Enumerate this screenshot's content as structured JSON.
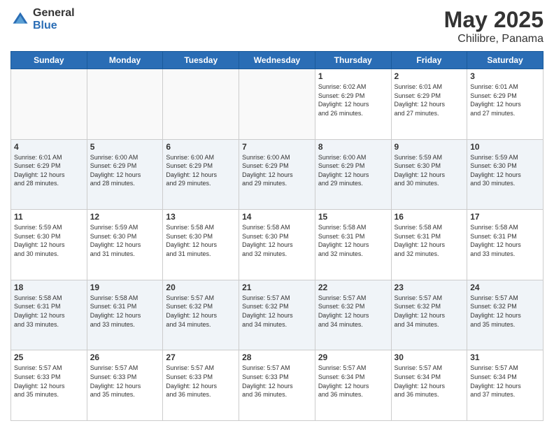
{
  "header": {
    "logo_general": "General",
    "logo_blue": "Blue",
    "title": "May 2025",
    "location": "Chilibre, Panama"
  },
  "weekdays": [
    "Sunday",
    "Monday",
    "Tuesday",
    "Wednesday",
    "Thursday",
    "Friday",
    "Saturday"
  ],
  "weeks": [
    [
      {
        "day": "",
        "empty": true
      },
      {
        "day": "",
        "empty": true
      },
      {
        "day": "",
        "empty": true
      },
      {
        "day": "",
        "empty": true
      },
      {
        "day": "1",
        "sunrise": "6:02 AM",
        "sunset": "6:29 PM",
        "daylight": "12 hours and 26 minutes."
      },
      {
        "day": "2",
        "sunrise": "6:01 AM",
        "sunset": "6:29 PM",
        "daylight": "12 hours and 27 minutes."
      },
      {
        "day": "3",
        "sunrise": "6:01 AM",
        "sunset": "6:29 PM",
        "daylight": "12 hours and 27 minutes."
      }
    ],
    [
      {
        "day": "4",
        "sunrise": "6:01 AM",
        "sunset": "6:29 PM",
        "daylight": "12 hours and 28 minutes."
      },
      {
        "day": "5",
        "sunrise": "6:00 AM",
        "sunset": "6:29 PM",
        "daylight": "12 hours and 28 minutes."
      },
      {
        "day": "6",
        "sunrise": "6:00 AM",
        "sunset": "6:29 PM",
        "daylight": "12 hours and 29 minutes."
      },
      {
        "day": "7",
        "sunrise": "6:00 AM",
        "sunset": "6:29 PM",
        "daylight": "12 hours and 29 minutes."
      },
      {
        "day": "8",
        "sunrise": "6:00 AM",
        "sunset": "6:29 PM",
        "daylight": "12 hours and 29 minutes."
      },
      {
        "day": "9",
        "sunrise": "5:59 AM",
        "sunset": "6:30 PM",
        "daylight": "12 hours and 30 minutes."
      },
      {
        "day": "10",
        "sunrise": "5:59 AM",
        "sunset": "6:30 PM",
        "daylight": "12 hours and 30 minutes."
      }
    ],
    [
      {
        "day": "11",
        "sunrise": "5:59 AM",
        "sunset": "6:30 PM",
        "daylight": "12 hours and 30 minutes."
      },
      {
        "day": "12",
        "sunrise": "5:59 AM",
        "sunset": "6:30 PM",
        "daylight": "12 hours and 31 minutes."
      },
      {
        "day": "13",
        "sunrise": "5:58 AM",
        "sunset": "6:30 PM",
        "daylight": "12 hours and 31 minutes."
      },
      {
        "day": "14",
        "sunrise": "5:58 AM",
        "sunset": "6:30 PM",
        "daylight": "12 hours and 32 minutes."
      },
      {
        "day": "15",
        "sunrise": "5:58 AM",
        "sunset": "6:31 PM",
        "daylight": "12 hours and 32 minutes."
      },
      {
        "day": "16",
        "sunrise": "5:58 AM",
        "sunset": "6:31 PM",
        "daylight": "12 hours and 32 minutes."
      },
      {
        "day": "17",
        "sunrise": "5:58 AM",
        "sunset": "6:31 PM",
        "daylight": "12 hours and 33 minutes."
      }
    ],
    [
      {
        "day": "18",
        "sunrise": "5:58 AM",
        "sunset": "6:31 PM",
        "daylight": "12 hours and 33 minutes."
      },
      {
        "day": "19",
        "sunrise": "5:58 AM",
        "sunset": "6:31 PM",
        "daylight": "12 hours and 33 minutes."
      },
      {
        "day": "20",
        "sunrise": "5:57 AM",
        "sunset": "6:32 PM",
        "daylight": "12 hours and 34 minutes."
      },
      {
        "day": "21",
        "sunrise": "5:57 AM",
        "sunset": "6:32 PM",
        "daylight": "12 hours and 34 minutes."
      },
      {
        "day": "22",
        "sunrise": "5:57 AM",
        "sunset": "6:32 PM",
        "daylight": "12 hours and 34 minutes."
      },
      {
        "day": "23",
        "sunrise": "5:57 AM",
        "sunset": "6:32 PM",
        "daylight": "12 hours and 34 minutes."
      },
      {
        "day": "24",
        "sunrise": "5:57 AM",
        "sunset": "6:32 PM",
        "daylight": "12 hours and 35 minutes."
      }
    ],
    [
      {
        "day": "25",
        "sunrise": "5:57 AM",
        "sunset": "6:33 PM",
        "daylight": "12 hours and 35 minutes."
      },
      {
        "day": "26",
        "sunrise": "5:57 AM",
        "sunset": "6:33 PM",
        "daylight": "12 hours and 35 minutes."
      },
      {
        "day": "27",
        "sunrise": "5:57 AM",
        "sunset": "6:33 PM",
        "daylight": "12 hours and 36 minutes."
      },
      {
        "day": "28",
        "sunrise": "5:57 AM",
        "sunset": "6:33 PM",
        "daylight": "12 hours and 36 minutes."
      },
      {
        "day": "29",
        "sunrise": "5:57 AM",
        "sunset": "6:34 PM",
        "daylight": "12 hours and 36 minutes."
      },
      {
        "day": "30",
        "sunrise": "5:57 AM",
        "sunset": "6:34 PM",
        "daylight": "12 hours and 36 minutes."
      },
      {
        "day": "31",
        "sunrise": "5:57 AM",
        "sunset": "6:34 PM",
        "daylight": "12 hours and 37 minutes."
      }
    ]
  ]
}
